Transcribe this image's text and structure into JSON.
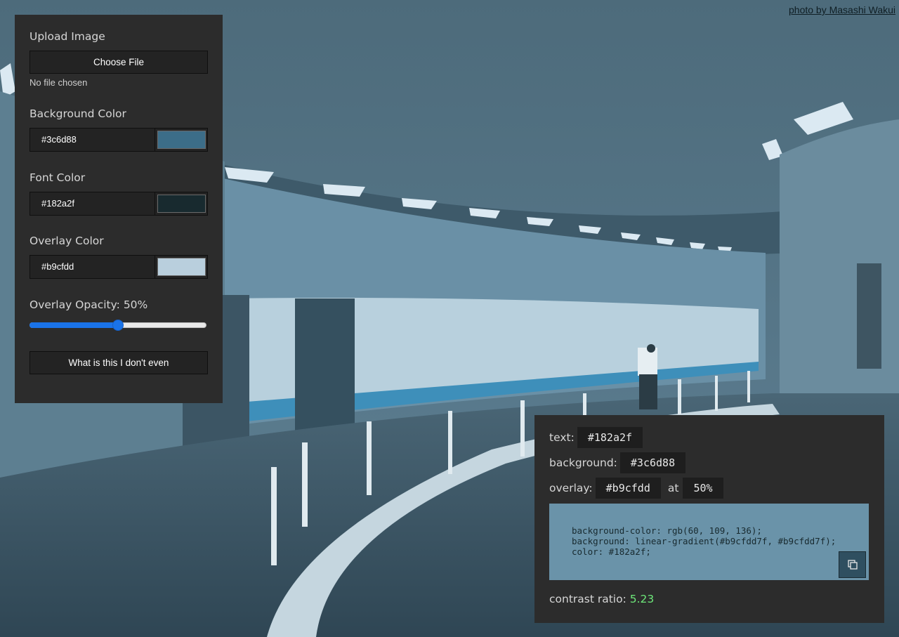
{
  "credit": {
    "text": "photo by Masashi Wakui"
  },
  "controls": {
    "upload": {
      "label": "Upload Image",
      "button_label": "Choose File",
      "status": "No file chosen"
    },
    "background_color": {
      "label": "Background Color",
      "value": "#3c6d88",
      "swatch": "#3c6d88"
    },
    "font_color": {
      "label": "Font Color",
      "value": "#182a2f",
      "swatch": "#182a2f"
    },
    "overlay_color": {
      "label": "Overlay Color",
      "value": "#b9cfdd",
      "swatch": "#b9cfdd"
    },
    "overlay_opacity": {
      "label": "Overlay Opacity: 50%",
      "value_percent": 50
    },
    "action_button": "What is this I don't even"
  },
  "info": {
    "text_label": "text:",
    "text_value": "#182a2f",
    "background_label": "background:",
    "background_value": "#3c6d88",
    "overlay_label": "overlay:",
    "overlay_value": "#b9cfdd",
    "at_label": "at",
    "opacity_value": "50%",
    "css_line1": "background-color: rgb(60, 109, 136);",
    "css_line2": "background: linear-gradient(#b9cfdd7f, #b9cfdd7f);",
    "css_line3": "color: #182a2f;",
    "copy_icon": "copy-icon",
    "contrast_label": "contrast ratio:",
    "contrast_value": "5.23"
  },
  "colors": {
    "panel_bg": "#2c2c2c",
    "code_bg": "#6a93a9",
    "accent": "#1a73e8",
    "contrast_good": "#6ee87a"
  }
}
